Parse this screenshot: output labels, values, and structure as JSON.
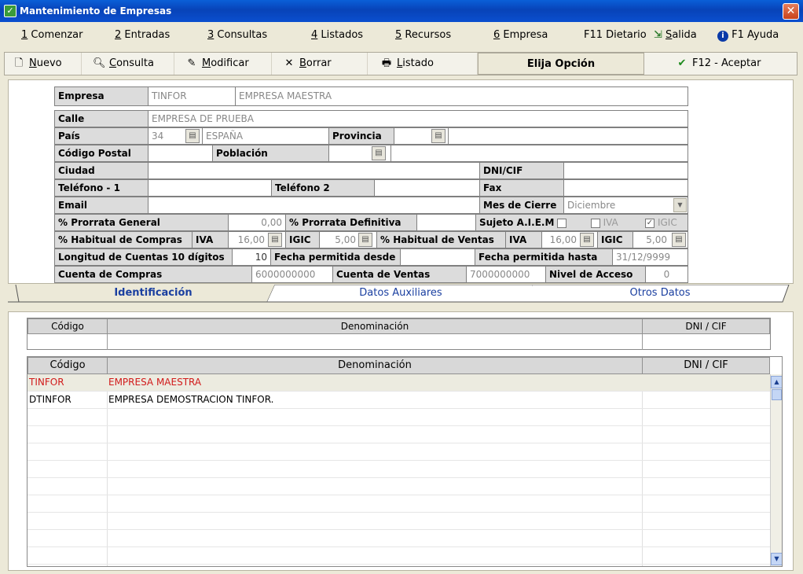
{
  "window": {
    "title": "Mantenimiento de Empresas"
  },
  "menu": [
    {
      "key": "1",
      "label": " Comenzar"
    },
    {
      "key": "2",
      "label": " Entradas"
    },
    {
      "key": "3",
      "label": " Consultas"
    },
    {
      "key": "4",
      "label": " Listados"
    },
    {
      "key": "5",
      "label": " Recursos"
    },
    {
      "key": "6",
      "label": " Empresa"
    }
  ],
  "menu_right": {
    "dietario": "F11 Dietario",
    "salida_key": "S",
    "salida_rest": "alida",
    "ayuda": "F1 Ayuda"
  },
  "toolbar": {
    "nuevo_key": "N",
    "nuevo_rest": "uevo",
    "consulta_key": "C",
    "consulta_rest": "onsulta",
    "modificar_key": "M",
    "modificar_rest": "odificar",
    "borrar_key": "B",
    "borrar_rest": "orrar",
    "listado_key": "L",
    "listado_rest": "istado",
    "elija": "Elija Opción",
    "aceptar": "F12 - Aceptar"
  },
  "form": {
    "empresa_label": "Empresa",
    "empresa_code": "TINFOR",
    "empresa_name": "EMPRESA MAESTRA",
    "calle_label": "Calle",
    "calle_value": "EMPRESA DE PRUEBA",
    "pais_label": "País",
    "pais_code": "34",
    "pais_name": "ESPAÑA",
    "provincia_label": "Provincia",
    "provincia_value": "",
    "cp_label": "Código Postal",
    "cp_value": "",
    "poblacion_label": "Población",
    "poblacion_value": "",
    "ciudad_label": "Ciudad",
    "ciudad_value": "",
    "dni_label": "DNI/CIF",
    "dni_value": "",
    "tel1_label": "Teléfono - 1",
    "tel1_value": "",
    "tel2_label": "Teléfono 2",
    "tel2_value": "",
    "fax_label": "Fax",
    "fax_value": "",
    "email_label": "Email",
    "email_value": "",
    "mes_label": "Mes de Cierre",
    "mes_value": "Diciembre",
    "prorrata_gen_label": "% Prorrata General",
    "prorrata_gen_value": "0,00",
    "prorrata_def_label": "% Prorrata Definitiva",
    "prorrata_def_value": "",
    "sujeto_label": "Sujeto A.I.E.M",
    "sujeto_checked": false,
    "iva_check_label": "IVA",
    "iva_checked": false,
    "igic_check_label": "IGIC",
    "igic_checked": true,
    "hab_compras_label": "% Habitual  de Compras",
    "iva_label": "IVA",
    "iva_compras": "16,00",
    "igic_label": "IGIC",
    "igic_compras": "5,00",
    "hab_ventas_label": "% Habitual de Ventas",
    "iva_ventas": "16,00",
    "igic_ventas": "5,00",
    "longitud_label": "Longitud de Cuentas  10 dígitos",
    "longitud_value": "10",
    "fecha_desde_label": "Fecha permitida desde",
    "fecha_desde_value": "",
    "fecha_hasta_label": "Fecha permitida hasta",
    "fecha_hasta_value": "31/12/9999",
    "cta_compras_label": "Cuenta de Compras",
    "cta_compras_value": "6000000000",
    "cta_ventas_label": "Cuenta de Ventas",
    "cta_ventas_value": "7000000000",
    "nivel_label": "Nivel de Acceso",
    "nivel_value": "0"
  },
  "tabs": [
    "Identificación",
    "Datos Auxiliares",
    "Otros Datos"
  ],
  "filter": {
    "headers": [
      "Código",
      "Denominación",
      "DNI / CIF"
    ],
    "values": [
      "",
      "",
      ""
    ]
  },
  "list": {
    "headers": [
      "Código",
      "Denominación",
      "DNI / CIF"
    ],
    "rows": [
      {
        "codigo": "TINFOR",
        "denominacion": "EMPRESA MAESTRA",
        "dni": ""
      },
      {
        "codigo": "DTINFOR",
        "denominacion": "EMPRESA DEMOSTRACION TINFOR.",
        "dni": ""
      }
    ]
  },
  "colors": {
    "title_bar": "#0a4fcf",
    "selected_row_text": "#d11a1a",
    "tab_text": "#1a3fa0"
  }
}
